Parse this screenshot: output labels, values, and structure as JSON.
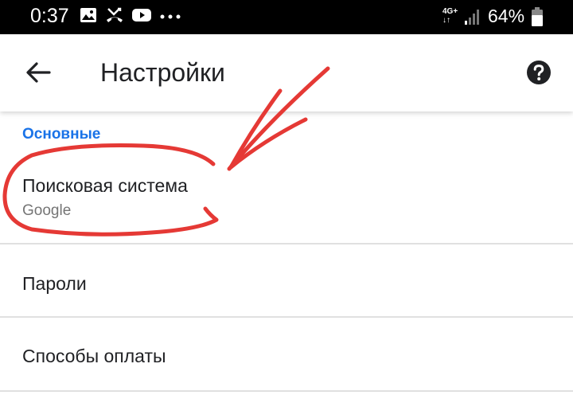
{
  "status_bar": {
    "time": "0:37",
    "network_top": "4G+",
    "network_bottom": "↓↑",
    "battery_percent": "64%",
    "icons": [
      "image-icon",
      "missed-call-icon",
      "youtube-icon",
      "more-dots-icon",
      "signal-icon",
      "battery-icon"
    ]
  },
  "app_bar": {
    "title": "Настройки",
    "back_icon": "arrow-back-icon",
    "help_icon": "help-icon"
  },
  "section": {
    "header": "Основные"
  },
  "items": [
    {
      "title": "Поисковая система",
      "subtitle": "Google"
    },
    {
      "title": "Пароли"
    },
    {
      "title": "Способы оплаты"
    }
  ],
  "colors": {
    "accent": "#1a73e8",
    "annotation": "#e53935",
    "status_bar": "#000000"
  }
}
